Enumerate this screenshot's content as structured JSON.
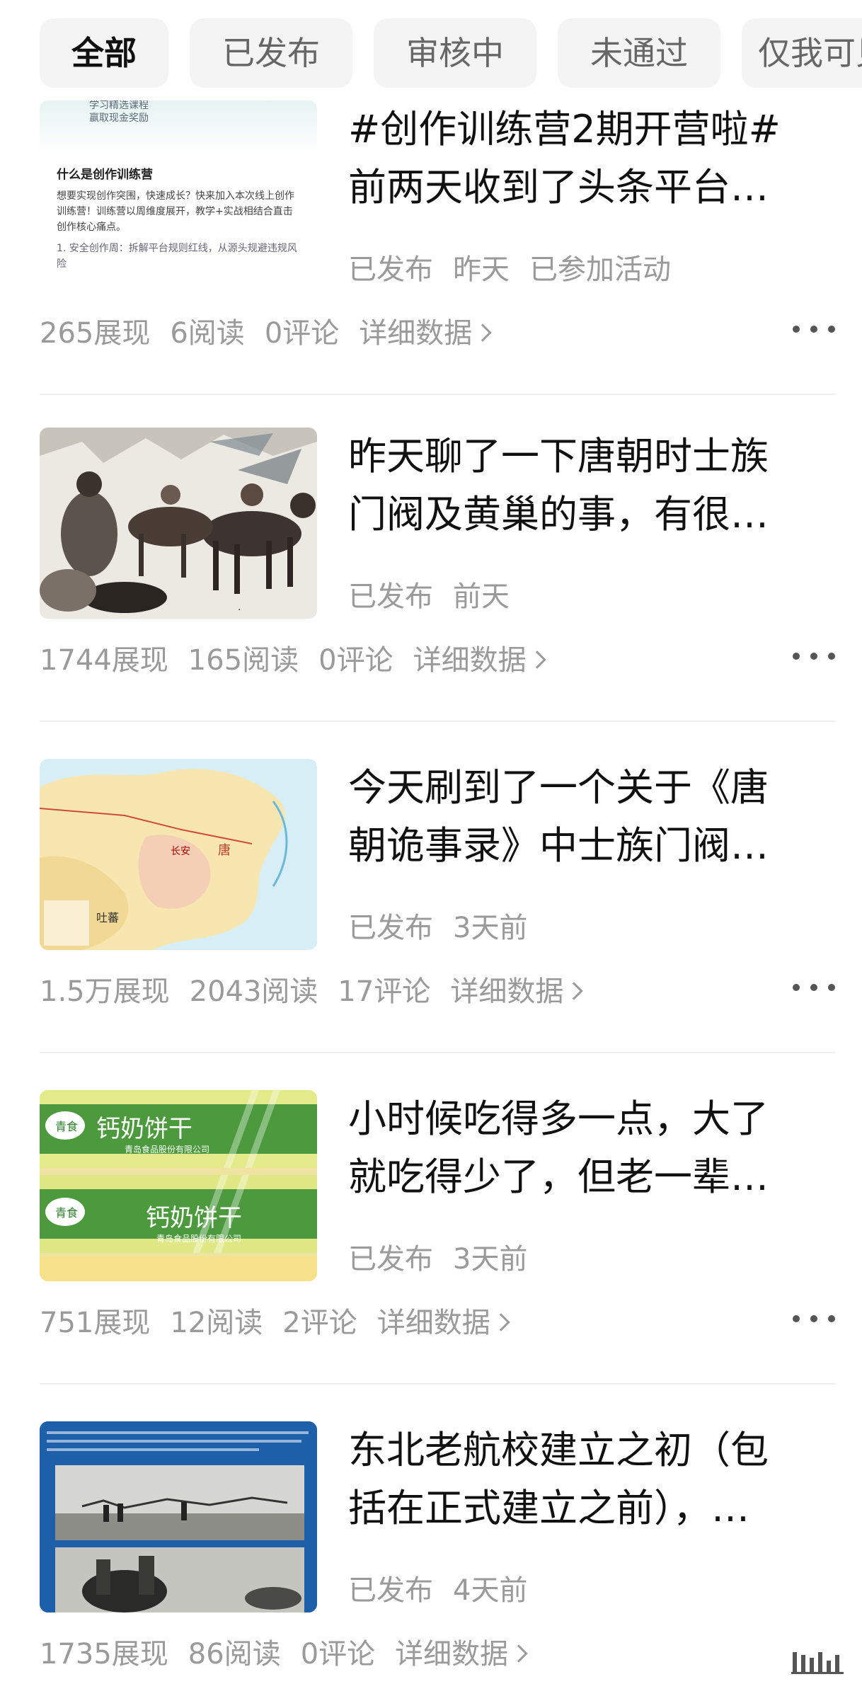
{
  "tabs": [
    {
      "label": "全部",
      "active": true
    },
    {
      "label": "已发布",
      "active": false
    },
    {
      "label": "审核中",
      "active": false
    },
    {
      "label": "未通过",
      "active": false
    },
    {
      "label": "仅我可见",
      "active": false
    }
  ],
  "articles": [
    {
      "title_line1": "#创作训练营2期开营啦#",
      "title_line2": "前两天收到了头条平台…",
      "status": "已发布",
      "time": "昨天",
      "tag": "已参加活动",
      "views": "265展现",
      "reads": "6阅读",
      "comments": "0评论",
      "detail": "详细数据",
      "thumb": {
        "header1": "学习精选课程",
        "header2": "赢取现金奖励",
        "heading": "什么是创作训练营",
        "body": "想要实现创作突围，快速成长？快来加入本次线上创作训练营！训练营以周维度展开，教学+实战相结合直击创作核心痛点。",
        "item": "1. 安全创作周：拆解平台规则红线，从源头规避违规风险"
      }
    },
    {
      "title_line1": "昨天聊了一下唐朝时士族",
      "title_line2": "门阀及黄巢的事，有很…",
      "status": "已发布",
      "time": "前天",
      "views": "1744展现",
      "reads": "165阅读",
      "comments": "0评论",
      "detail": "详细数据"
    },
    {
      "title_line1": "今天刷到了一个关于《唐",
      "title_line2": "朝诡事录》中士族门阀…",
      "status": "已发布",
      "time": "3天前",
      "views": "1.5万展现",
      "reads": "2043阅读",
      "comments": "17评论",
      "detail": "详细数据",
      "thumb": {
        "label1": "长安",
        "label2": "唐",
        "label3": "吐蕃"
      }
    },
    {
      "title_line1": "小时候吃得多一点，大了",
      "title_line2": "就吃得少了，但老一辈…",
      "status": "已发布",
      "time": "3天前",
      "views": "751展现",
      "reads": "12阅读",
      "comments": "2评论",
      "detail": "详细数据",
      "thumb": {
        "brand": "青食",
        "product": "钙奶饼干",
        "company": "青岛食品股份有限公司"
      }
    },
    {
      "title_line1": "东北老航校建立之初（包",
      "title_line2": "括在正式建立之前），…",
      "status": "已发布",
      "time": "4天前",
      "views": "1735展现",
      "reads": "86阅读",
      "comments": "0评论",
      "detail": "详细数据"
    }
  ],
  "colors": {
    "tab_bg": "#f4f4f4",
    "meta_gray": "#9a9a9a",
    "title": "#111111"
  }
}
